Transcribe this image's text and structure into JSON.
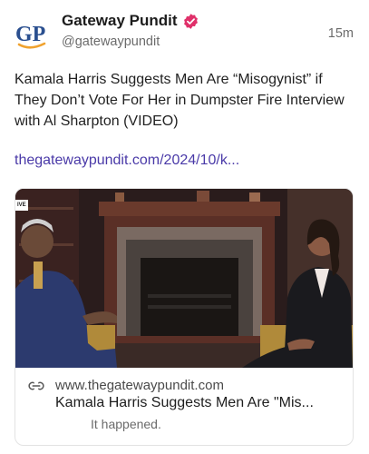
{
  "post": {
    "author_name": "Gateway Pundit",
    "handle": "@gatewaypundit",
    "time": "15m",
    "avatar_text": "GP",
    "avatar_icon": "gateway-pundit-logo",
    "verified_icon": "verified-badge-icon",
    "text": "Kamala Harris Suggests Men Are “Misogynist” if They Don’t Vote For Her in Dumpster Fire Interview with Al Sharpton (VIDEO)",
    "link": "thegatewaypundit.com/2024/10/k...",
    "colors": {
      "link": "#4a3aa8",
      "verified": "#e0306a",
      "avatar_blue": "#2a4f8f",
      "avatar_orange": "#f0a22e"
    }
  },
  "card": {
    "image_alt": "interview-thumbnail",
    "live_tag": "IVE",
    "link_icon": "link-icon",
    "domain": "www.thegatewaypundit.com",
    "title": "Kamala Harris Suggests Men Are \"Mis...",
    "description": "It happened."
  }
}
